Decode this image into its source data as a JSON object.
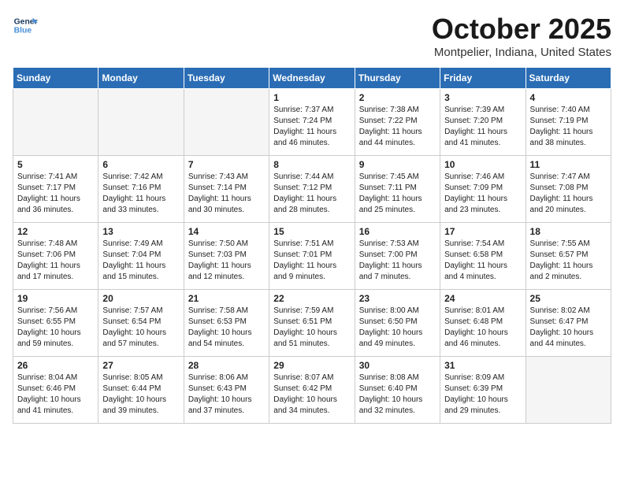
{
  "header": {
    "logo_line1": "General",
    "logo_line2": "Blue",
    "title": "October 2025",
    "subtitle": "Montpelier, Indiana, United States"
  },
  "days_of_week": [
    "Sunday",
    "Monday",
    "Tuesday",
    "Wednesday",
    "Thursday",
    "Friday",
    "Saturday"
  ],
  "weeks": [
    [
      {
        "day": "",
        "info": ""
      },
      {
        "day": "",
        "info": ""
      },
      {
        "day": "",
        "info": ""
      },
      {
        "day": "1",
        "info": "Sunrise: 7:37 AM\nSunset: 7:24 PM\nDaylight: 11 hours\nand 46 minutes."
      },
      {
        "day": "2",
        "info": "Sunrise: 7:38 AM\nSunset: 7:22 PM\nDaylight: 11 hours\nand 44 minutes."
      },
      {
        "day": "3",
        "info": "Sunrise: 7:39 AM\nSunset: 7:20 PM\nDaylight: 11 hours\nand 41 minutes."
      },
      {
        "day": "4",
        "info": "Sunrise: 7:40 AM\nSunset: 7:19 PM\nDaylight: 11 hours\nand 38 minutes."
      }
    ],
    [
      {
        "day": "5",
        "info": "Sunrise: 7:41 AM\nSunset: 7:17 PM\nDaylight: 11 hours\nand 36 minutes."
      },
      {
        "day": "6",
        "info": "Sunrise: 7:42 AM\nSunset: 7:16 PM\nDaylight: 11 hours\nand 33 minutes."
      },
      {
        "day": "7",
        "info": "Sunrise: 7:43 AM\nSunset: 7:14 PM\nDaylight: 11 hours\nand 30 minutes."
      },
      {
        "day": "8",
        "info": "Sunrise: 7:44 AM\nSunset: 7:12 PM\nDaylight: 11 hours\nand 28 minutes."
      },
      {
        "day": "9",
        "info": "Sunrise: 7:45 AM\nSunset: 7:11 PM\nDaylight: 11 hours\nand 25 minutes."
      },
      {
        "day": "10",
        "info": "Sunrise: 7:46 AM\nSunset: 7:09 PM\nDaylight: 11 hours\nand 23 minutes."
      },
      {
        "day": "11",
        "info": "Sunrise: 7:47 AM\nSunset: 7:08 PM\nDaylight: 11 hours\nand 20 minutes."
      }
    ],
    [
      {
        "day": "12",
        "info": "Sunrise: 7:48 AM\nSunset: 7:06 PM\nDaylight: 11 hours\nand 17 minutes."
      },
      {
        "day": "13",
        "info": "Sunrise: 7:49 AM\nSunset: 7:04 PM\nDaylight: 11 hours\nand 15 minutes."
      },
      {
        "day": "14",
        "info": "Sunrise: 7:50 AM\nSunset: 7:03 PM\nDaylight: 11 hours\nand 12 minutes."
      },
      {
        "day": "15",
        "info": "Sunrise: 7:51 AM\nSunset: 7:01 PM\nDaylight: 11 hours\nand 9 minutes."
      },
      {
        "day": "16",
        "info": "Sunrise: 7:53 AM\nSunset: 7:00 PM\nDaylight: 11 hours\nand 7 minutes."
      },
      {
        "day": "17",
        "info": "Sunrise: 7:54 AM\nSunset: 6:58 PM\nDaylight: 11 hours\nand 4 minutes."
      },
      {
        "day": "18",
        "info": "Sunrise: 7:55 AM\nSunset: 6:57 PM\nDaylight: 11 hours\nand 2 minutes."
      }
    ],
    [
      {
        "day": "19",
        "info": "Sunrise: 7:56 AM\nSunset: 6:55 PM\nDaylight: 10 hours\nand 59 minutes."
      },
      {
        "day": "20",
        "info": "Sunrise: 7:57 AM\nSunset: 6:54 PM\nDaylight: 10 hours\nand 57 minutes."
      },
      {
        "day": "21",
        "info": "Sunrise: 7:58 AM\nSunset: 6:53 PM\nDaylight: 10 hours\nand 54 minutes."
      },
      {
        "day": "22",
        "info": "Sunrise: 7:59 AM\nSunset: 6:51 PM\nDaylight: 10 hours\nand 51 minutes."
      },
      {
        "day": "23",
        "info": "Sunrise: 8:00 AM\nSunset: 6:50 PM\nDaylight: 10 hours\nand 49 minutes."
      },
      {
        "day": "24",
        "info": "Sunrise: 8:01 AM\nSunset: 6:48 PM\nDaylight: 10 hours\nand 46 minutes."
      },
      {
        "day": "25",
        "info": "Sunrise: 8:02 AM\nSunset: 6:47 PM\nDaylight: 10 hours\nand 44 minutes."
      }
    ],
    [
      {
        "day": "26",
        "info": "Sunrise: 8:04 AM\nSunset: 6:46 PM\nDaylight: 10 hours\nand 41 minutes."
      },
      {
        "day": "27",
        "info": "Sunrise: 8:05 AM\nSunset: 6:44 PM\nDaylight: 10 hours\nand 39 minutes."
      },
      {
        "day": "28",
        "info": "Sunrise: 8:06 AM\nSunset: 6:43 PM\nDaylight: 10 hours\nand 37 minutes."
      },
      {
        "day": "29",
        "info": "Sunrise: 8:07 AM\nSunset: 6:42 PM\nDaylight: 10 hours\nand 34 minutes."
      },
      {
        "day": "30",
        "info": "Sunrise: 8:08 AM\nSunset: 6:40 PM\nDaylight: 10 hours\nand 32 minutes."
      },
      {
        "day": "31",
        "info": "Sunrise: 8:09 AM\nSunset: 6:39 PM\nDaylight: 10 hours\nand 29 minutes."
      },
      {
        "day": "",
        "info": ""
      }
    ]
  ]
}
